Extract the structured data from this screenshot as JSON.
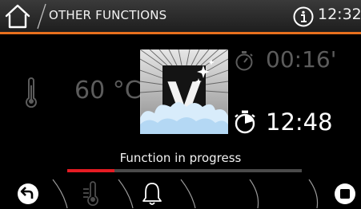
{
  "header": {
    "title": "OTHER FUNCTIONS",
    "clock": "12:32",
    "home_icon": "home-icon",
    "info_icon": "info-icon"
  },
  "main": {
    "temperature": "60 °C",
    "function_icon": "vapour-clean-icon",
    "function_letter": "V",
    "duration": "00:16'",
    "end_time": "12:48",
    "status": "Function in progress",
    "progress": 0.2
  },
  "bottom_bar": {
    "buttons": [
      "back-icon",
      "preheat-icon",
      "bell-icon",
      "stop-icon"
    ]
  },
  "colors": {
    "accent": "#e8701e",
    "progress": "#e51c23",
    "dim_text": "#5c5c5c",
    "text": "#f2f2f2"
  }
}
